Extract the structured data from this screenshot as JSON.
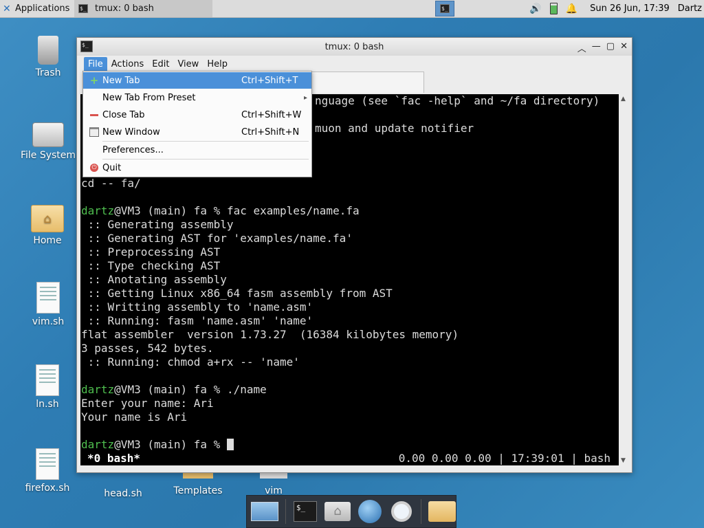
{
  "panel": {
    "applications_label": "Applications",
    "task_label": "tmux: 0 bash",
    "clock": "Sun 26 Jun, 17:39",
    "user": "Dartz",
    "tray_icons": [
      "volume-icon",
      "battery-icon",
      "notification-bell-icon"
    ]
  },
  "desktop": {
    "icons": [
      {
        "label": "Trash",
        "icon": "trash-icon"
      },
      {
        "label": "File System",
        "icon": "drive-icon"
      },
      {
        "label": "Home",
        "icon": "home-folder-icon"
      },
      {
        "label": "vim.sh",
        "icon": "script-file-icon"
      },
      {
        "label": "ln.sh",
        "icon": "script-file-icon"
      },
      {
        "label": "firefox.sh",
        "icon": "script-file-icon"
      },
      {
        "label": "head.sh",
        "icon": "script-file-icon"
      },
      {
        "label": "Templates",
        "icon": "folder-icon"
      },
      {
        "label": "vim",
        "icon": "folder-icon"
      }
    ]
  },
  "window": {
    "title": "tmux: 0 bash",
    "menus": [
      "File",
      "Actions",
      "Edit",
      "View",
      "Help"
    ],
    "active_menu": "File"
  },
  "file_menu": {
    "items": [
      {
        "label": "New Tab",
        "accel": "Ctrl+Shift+T",
        "icon": "plus-icon",
        "highlighted": true
      },
      {
        "label": "New Tab From Preset",
        "accel": "",
        "icon": "",
        "submenu": true
      },
      {
        "label": "Close Tab",
        "accel": "Ctrl+Shift+W",
        "icon": "minus-icon"
      },
      {
        "label": "New Window",
        "accel": "Ctrl+Shift+N",
        "icon": "new-window-icon"
      },
      {
        "label": "Preferences...",
        "accel": "",
        "icon": ""
      },
      {
        "label": "Quit",
        "accel": "",
        "icon": "power-icon"
      }
    ]
  },
  "terminal": {
    "partial_line_1": "nguage (see `fac -help` and ~/fa directory)",
    "partial_line_2": "muon and update notifier",
    "cd_line": "cd -- fa/",
    "prompt_user": "dartz",
    "prompt_rest": "@VM3 (main) fa % ",
    "cmd1": "fac examples/name.fa",
    "output1": [
      " :: Generating assembly",
      " :: Generating AST for 'examples/name.fa'",
      " :: Preprocessing AST",
      " :: Type checking AST",
      " :: Anotating assembly",
      " :: Getting Linux x86_64 fasm assembly from AST",
      " :: Writting assembly to 'name.asm'",
      " :: Running: fasm 'name.asm' 'name'",
      "flat assembler  version 1.73.27  (16384 kilobytes memory)",
      "3 passes, 542 bytes.",
      " :: Running: chmod a+rx -- 'name'"
    ],
    "cmd2": "./name",
    "output2": [
      "Enter your name: Ari",
      "Your name is Ari"
    ],
    "status_left": "*0 bash*",
    "status_right": "0.00 0.00 0.00 | 17:39:01 | bash"
  },
  "dock": {
    "items": [
      "show-desktop-icon",
      "terminal-icon",
      "home-icon",
      "web-browser-icon",
      "search-icon",
      "file-manager-icon"
    ]
  }
}
